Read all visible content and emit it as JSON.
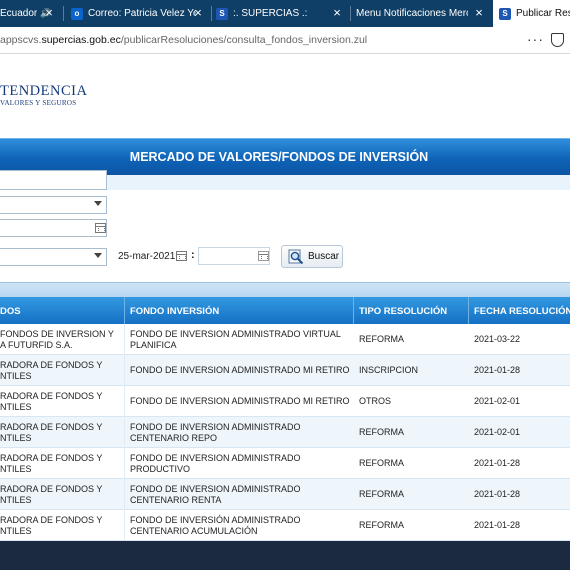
{
  "browser": {
    "tabs": [
      {
        "label": "Ecuador",
        "has_audio_icon": true
      },
      {
        "label": "Correo: Patricia Velez Yen"
      },
      {
        "label": ":. SUPERCIAS .:"
      },
      {
        "label": "Menu Notificaciones Mercad"
      },
      {
        "label": "Publicar Resolu",
        "active": true
      }
    ],
    "url_prefix": "appscvs.",
    "url_host": "supercias.gob.ec",
    "url_path": "/publicarResoluciones/consulta_fondos_inversion.zul",
    "more_label": "···"
  },
  "logo": {
    "line1": "TENDENCIA",
    "line2": "VALORES Y SEGUROS"
  },
  "banner": {
    "title": "MERCADO DE VALORES/FONDOS DE INVERSIÓN"
  },
  "search": {
    "date_from": "25-mar-2021",
    "button_label": "Buscar"
  },
  "table": {
    "columns": [
      "DOS",
      "FONDO INVERSIÓN",
      "TIPO RESOLUCIÓN",
      "FECHA RESOLUCIÓN"
    ],
    "rows": [
      {
        "admin": "FONDOS DE INVERSION Y\nA FUTURFID S.A.",
        "fondo": "FONDO DE INVERSION ADMINISTRADO VIRTUAL\nPLANIFICA",
        "tipo": "REFORMA",
        "fecha": "2021-03-22"
      },
      {
        "admin": "RADORA DE FONDOS Y\nNTILES",
        "fondo": "FONDO DE INVERSION ADMINISTRADO MI RETIRO",
        "tipo": "INSCRIPCION",
        "fecha": "2021-01-28"
      },
      {
        "admin": "RADORA DE FONDOS Y\nNTILES",
        "fondo": "FONDO DE INVERSION ADMINISTRADO MI RETIRO",
        "tipo": "OTROS",
        "fecha": "2021-02-01"
      },
      {
        "admin": "RADORA DE FONDOS Y\nNTILES",
        "fondo": "FONDO DE INVERSION ADMINISTRADO\nCENTENARIO REPO",
        "tipo": "REFORMA",
        "fecha": "2021-02-01"
      },
      {
        "admin": "RADORA DE FONDOS Y\nNTILES",
        "fondo": "FONDO DE INVERSION ADMINISTRADO\nPRODUCTIVO",
        "tipo": "REFORMA",
        "fecha": "2021-01-28"
      },
      {
        "admin": "RADORA DE FONDOS Y\nNTILES",
        "fondo": "FONDO DE INVERSION ADMINISTRADO\nCENTENARIO RENTA",
        "tipo": "REFORMA",
        "fecha": "2021-01-28"
      },
      {
        "admin": "RADORA DE FONDOS Y\nNTILES",
        "fondo": "FONDO DE INVERSIÓN ADMINISTRADO\nCENTENARIO ACUMULACIÓN",
        "tipo": "REFORMA",
        "fecha": "2021-01-28"
      }
    ]
  }
}
